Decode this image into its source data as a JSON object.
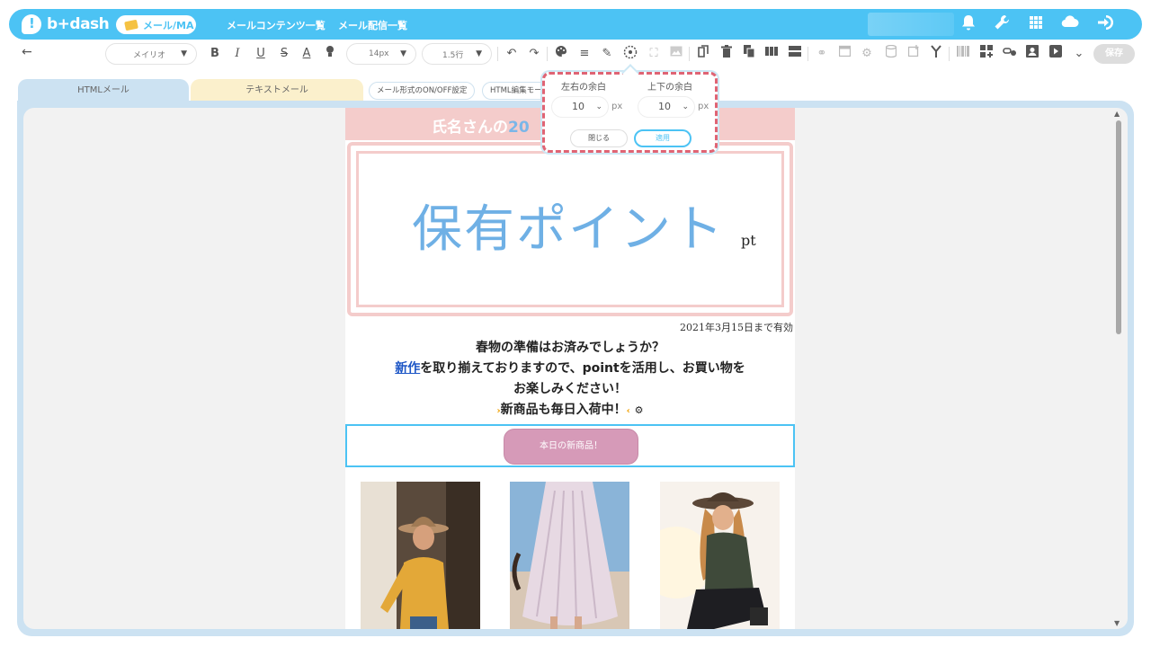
{
  "brand": {
    "logo_text": "b+dash"
  },
  "nav": {
    "active_label": "メール/MA",
    "links": [
      "メールコンテンツ一覧",
      "メール配信一覧"
    ],
    "icons": [
      "bell-icon",
      "wrench-icon",
      "grid-icon",
      "cloud-user-icon",
      "logout-icon"
    ]
  },
  "toolbar": {
    "font_family": "メイリオ",
    "font_size": "14px",
    "line_height": "1.5行",
    "save_label": "保存"
  },
  "tabs": {
    "html_mail": "HTMLメール",
    "text_mail": "テキストメール",
    "mail_format_toggle": "メール形式のON/OFF設定",
    "html_edit_mode": "HTML編集モー"
  },
  "popup": {
    "horizontal_label": "左右の余白",
    "vertical_label": "上下の余白",
    "horizontal_value": "10",
    "vertical_value": "10",
    "unit": "px",
    "close_label": "閉じる",
    "apply_label": "適用"
  },
  "email": {
    "header_text_prefix": "氏名さんの",
    "header_text_accent": "20",
    "point_title": "保有ポイント",
    "point_unit": "pt",
    "valid_until": "2021年3月15日まで有効",
    "line1": "春物の準備はお済みでしょうか？",
    "line2_link": "新作",
    "line2_rest": "を取り揃えておりますので、pointを活用し、お買い物を",
    "line3": "お楽しみください！",
    "line4": "新商品も毎日入荷中！",
    "cta_label": "本日の新商品！"
  },
  "colors": {
    "brand_blue": "#4cc3f4",
    "pink": "#f4cccb",
    "cta_pink": "#d69ab8",
    "point_blue": "#6fb0e5",
    "popup_dash": "#e06474"
  }
}
